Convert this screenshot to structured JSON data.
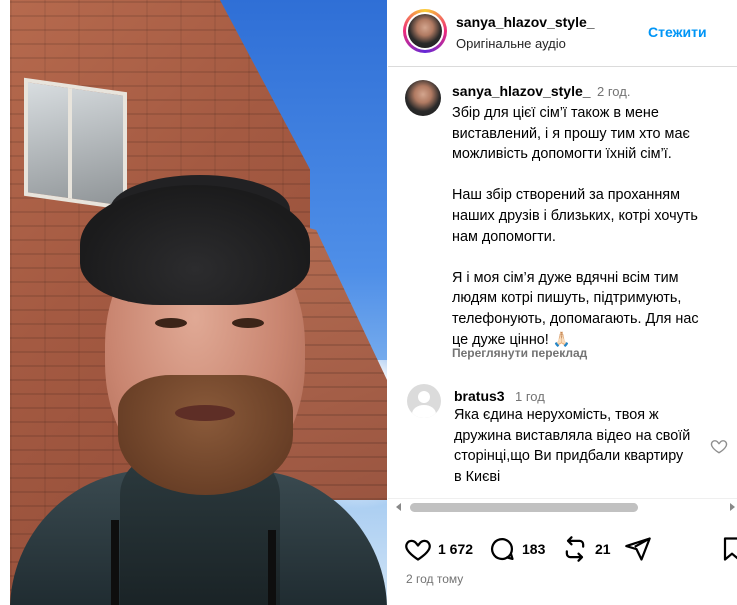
{
  "header": {
    "username": "sanya_hlazov_style_",
    "audio": "Оригінальне аудіо",
    "follow_label": "Стежити"
  },
  "post": {
    "username": "sanya_hlazov_style_",
    "time": "2 год.",
    "caption": "Збір для цієї сім’ї також в мене виставлений, і я прошу тим хто має можливість допомогти їхній сім’ї.\n\nНаш збір створений за проханням наших друзів і близьких, котрі хочуть нам допомогти.\n\nЯ і моя сім’я дуже вдячні всім тим людям котрі пишуть, підтримують, телефонують, допомагають. Для нас це дуже цінно! 🙏🏻",
    "translate_label": "Переглянути переклад"
  },
  "comment": {
    "username": "bratus3",
    "time": "1 год",
    "text": "Яка єдина нерухомість, твоя ж дружина виставляла відео на своїй сторінці,що Ви придбали квартиру в Києві"
  },
  "actions": {
    "likes": "1 672",
    "comments": "183",
    "reposts": "21"
  },
  "footer": {
    "time_ago": "2 год тому"
  },
  "icons": {
    "like": "heart-icon",
    "comment": "comment-icon",
    "repost": "repost-icon",
    "share": "send-icon",
    "save": "bookmark-icon",
    "comment_like": "heart-icon"
  },
  "colors": {
    "accent": "#0095f6",
    "muted": "#737373"
  }
}
